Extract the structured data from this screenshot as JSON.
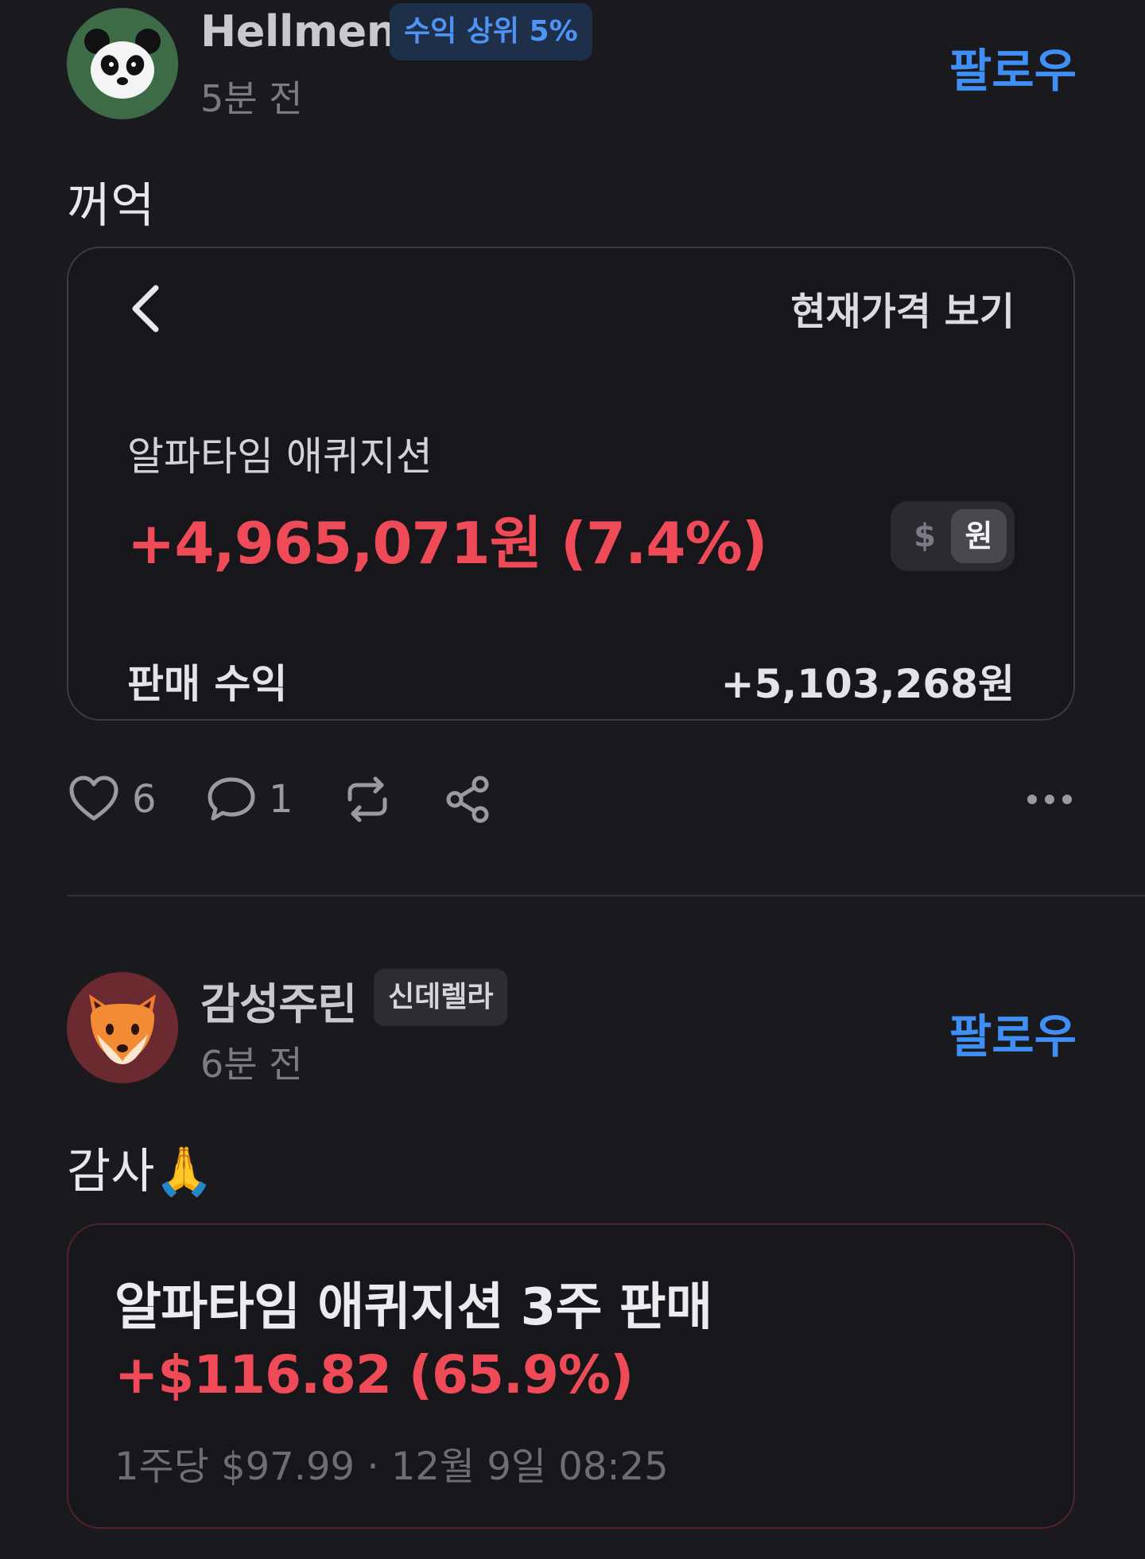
{
  "posts": [
    {
      "username": "Hellmen",
      "badge": "수익 상위 5%",
      "time": "5분 전",
      "follow_label": "팔로우",
      "text": "꺼억",
      "avatar_icon": "panda-icon",
      "card": {
        "back_icon": "chevron-left-icon",
        "current_price_label": "현재가격 보기",
        "stock_name": "알파타임 애퀴지션",
        "profit": "+4,965,071원 (7.4%)",
        "currency_usd": "$",
        "currency_krw": "원",
        "sale_label": "판매 수익",
        "sale_value": "+5,103,268원"
      },
      "actions": {
        "likes": "6",
        "comments": "1"
      }
    },
    {
      "username": "감성주린",
      "badge": "신데렐라",
      "time": "6분 전",
      "follow_label": "팔로우",
      "text": "감사🙏",
      "avatar_icon": "fox-icon",
      "trade": {
        "title": "알파타임 애퀴지션 3주 판매",
        "profit": "+$116.82 (65.9%)",
        "meta": "1주당 $97.99 · 12월 9일 08:25"
      }
    }
  ],
  "colors": {
    "background": "#19191e",
    "accent_blue": "#3f8ff5",
    "profit_red": "#ef4a58"
  }
}
